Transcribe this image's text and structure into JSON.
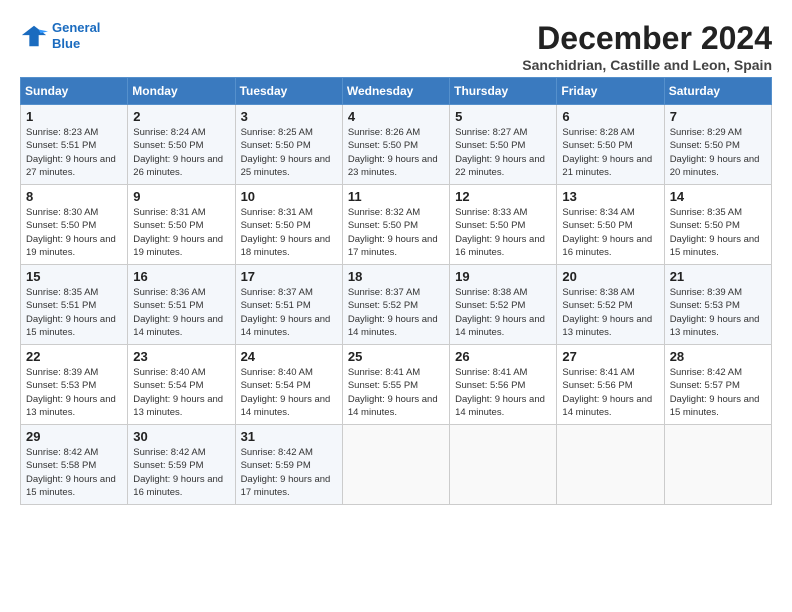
{
  "header": {
    "logo_line1": "General",
    "logo_line2": "Blue",
    "month_title": "December 2024",
    "location": "Sanchidrian, Castille and Leon, Spain"
  },
  "days_of_week": [
    "Sunday",
    "Monday",
    "Tuesday",
    "Wednesday",
    "Thursday",
    "Friday",
    "Saturday"
  ],
  "weeks": [
    [
      {
        "day": "1",
        "sunrise": "8:23 AM",
        "sunset": "5:51 PM",
        "daylight": "9 hours and 27 minutes."
      },
      {
        "day": "2",
        "sunrise": "8:24 AM",
        "sunset": "5:50 PM",
        "daylight": "9 hours and 26 minutes."
      },
      {
        "day": "3",
        "sunrise": "8:25 AM",
        "sunset": "5:50 PM",
        "daylight": "9 hours and 25 minutes."
      },
      {
        "day": "4",
        "sunrise": "8:26 AM",
        "sunset": "5:50 PM",
        "daylight": "9 hours and 23 minutes."
      },
      {
        "day": "5",
        "sunrise": "8:27 AM",
        "sunset": "5:50 PM",
        "daylight": "9 hours and 22 minutes."
      },
      {
        "day": "6",
        "sunrise": "8:28 AM",
        "sunset": "5:50 PM",
        "daylight": "9 hours and 21 minutes."
      },
      {
        "day": "7",
        "sunrise": "8:29 AM",
        "sunset": "5:50 PM",
        "daylight": "9 hours and 20 minutes."
      }
    ],
    [
      {
        "day": "8",
        "sunrise": "8:30 AM",
        "sunset": "5:50 PM",
        "daylight": "9 hours and 19 minutes."
      },
      {
        "day": "9",
        "sunrise": "8:31 AM",
        "sunset": "5:50 PM",
        "daylight": "9 hours and 19 minutes."
      },
      {
        "day": "10",
        "sunrise": "8:31 AM",
        "sunset": "5:50 PM",
        "daylight": "9 hours and 18 minutes."
      },
      {
        "day": "11",
        "sunrise": "8:32 AM",
        "sunset": "5:50 PM",
        "daylight": "9 hours and 17 minutes."
      },
      {
        "day": "12",
        "sunrise": "8:33 AM",
        "sunset": "5:50 PM",
        "daylight": "9 hours and 16 minutes."
      },
      {
        "day": "13",
        "sunrise": "8:34 AM",
        "sunset": "5:50 PM",
        "daylight": "9 hours and 16 minutes."
      },
      {
        "day": "14",
        "sunrise": "8:35 AM",
        "sunset": "5:50 PM",
        "daylight": "9 hours and 15 minutes."
      }
    ],
    [
      {
        "day": "15",
        "sunrise": "8:35 AM",
        "sunset": "5:51 PM",
        "daylight": "9 hours and 15 minutes."
      },
      {
        "day": "16",
        "sunrise": "8:36 AM",
        "sunset": "5:51 PM",
        "daylight": "9 hours and 14 minutes."
      },
      {
        "day": "17",
        "sunrise": "8:37 AM",
        "sunset": "5:51 PM",
        "daylight": "9 hours and 14 minutes."
      },
      {
        "day": "18",
        "sunrise": "8:37 AM",
        "sunset": "5:52 PM",
        "daylight": "9 hours and 14 minutes."
      },
      {
        "day": "19",
        "sunrise": "8:38 AM",
        "sunset": "5:52 PM",
        "daylight": "9 hours and 14 minutes."
      },
      {
        "day": "20",
        "sunrise": "8:38 AM",
        "sunset": "5:52 PM",
        "daylight": "9 hours and 13 minutes."
      },
      {
        "day": "21",
        "sunrise": "8:39 AM",
        "sunset": "5:53 PM",
        "daylight": "9 hours and 13 minutes."
      }
    ],
    [
      {
        "day": "22",
        "sunrise": "8:39 AM",
        "sunset": "5:53 PM",
        "daylight": "9 hours and 13 minutes."
      },
      {
        "day": "23",
        "sunrise": "8:40 AM",
        "sunset": "5:54 PM",
        "daylight": "9 hours and 13 minutes."
      },
      {
        "day": "24",
        "sunrise": "8:40 AM",
        "sunset": "5:54 PM",
        "daylight": "9 hours and 14 minutes."
      },
      {
        "day": "25",
        "sunrise": "8:41 AM",
        "sunset": "5:55 PM",
        "daylight": "9 hours and 14 minutes."
      },
      {
        "day": "26",
        "sunrise": "8:41 AM",
        "sunset": "5:56 PM",
        "daylight": "9 hours and 14 minutes."
      },
      {
        "day": "27",
        "sunrise": "8:41 AM",
        "sunset": "5:56 PM",
        "daylight": "9 hours and 14 minutes."
      },
      {
        "day": "28",
        "sunrise": "8:42 AM",
        "sunset": "5:57 PM",
        "daylight": "9 hours and 15 minutes."
      }
    ],
    [
      {
        "day": "29",
        "sunrise": "8:42 AM",
        "sunset": "5:58 PM",
        "daylight": "9 hours and 15 minutes."
      },
      {
        "day": "30",
        "sunrise": "8:42 AM",
        "sunset": "5:59 PM",
        "daylight": "9 hours and 16 minutes."
      },
      {
        "day": "31",
        "sunrise": "8:42 AM",
        "sunset": "5:59 PM",
        "daylight": "9 hours and 17 minutes."
      },
      null,
      null,
      null,
      null
    ]
  ]
}
